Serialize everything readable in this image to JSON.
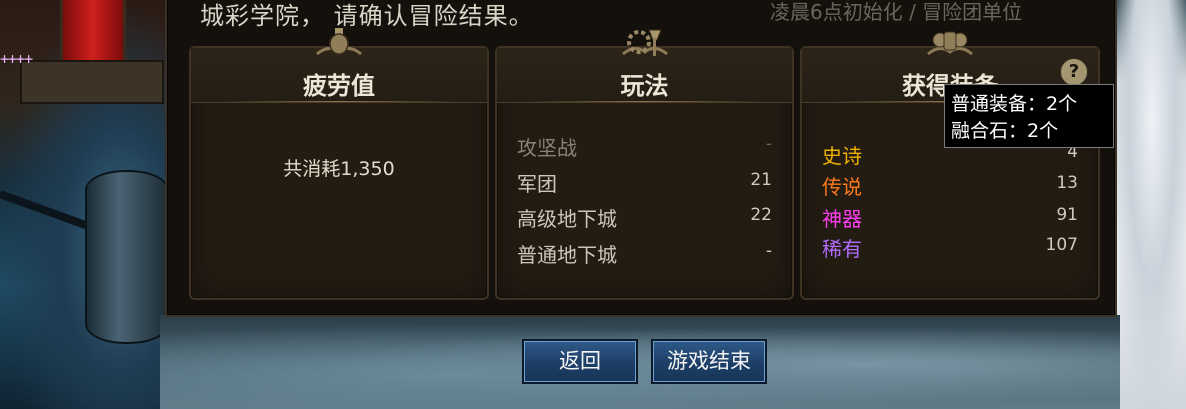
{
  "header": {
    "title": "城彩学院，  请确认冒险结果。",
    "subtitle_right": "凌晨6点初始化 / 冒险团单位"
  },
  "fatigue_card": {
    "title": "疲劳值",
    "consumed": "共消耗1,350"
  },
  "mode_card": {
    "title": "玩法",
    "rows": [
      {
        "label": "攻坚战",
        "value": "-"
      },
      {
        "label": "军团",
        "value": "21"
      },
      {
        "label": "高级地下城",
        "value": "22"
      },
      {
        "label": "普通地下城",
        "value": "-"
      }
    ]
  },
  "equip_card": {
    "title": "获得装备",
    "rows": [
      {
        "label": "史诗",
        "value": "4",
        "color": "#f0b000"
      },
      {
        "label": "传说",
        "value": "13",
        "color": "#ff7a1a"
      },
      {
        "label": "神器",
        "value": "91",
        "color": "#ff3df0"
      },
      {
        "label": "稀有",
        "value": "107",
        "color": "#b36bff"
      }
    ],
    "help_symbol": "?"
  },
  "tooltip": {
    "line1": "普通装备：2个",
    "line2": "融合石：2个"
  },
  "buttons": {
    "back": "返回",
    "end_game": "游戏结束"
  },
  "background": {
    "plus_marks": "++++"
  },
  "icons": {
    "fatigue": "potion-emblem-icon",
    "mode": "gear-axe-emblem-icon",
    "equip": "armor-emblem-icon",
    "help": "question-icon"
  }
}
